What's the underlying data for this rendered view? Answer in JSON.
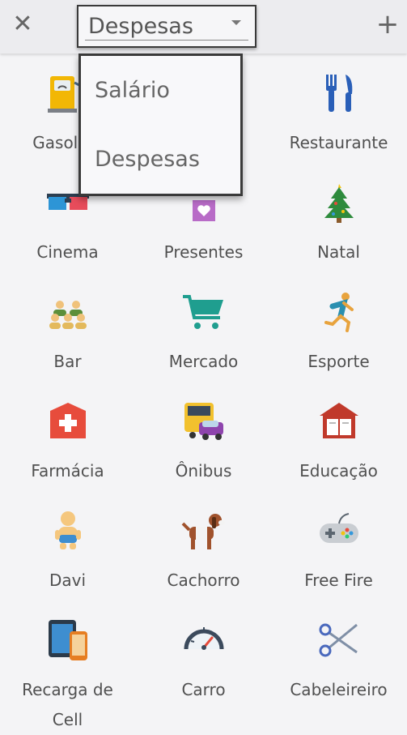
{
  "header": {
    "close_icon": "close-icon",
    "add_icon": "plus-icon",
    "selected_type": "Despesas"
  },
  "dropdown": {
    "options": [
      "Salário",
      "Despesas"
    ]
  },
  "categories": [
    {
      "label": "Gasolina",
      "icon": "fuel-pump-icon"
    },
    {
      "label": "",
      "icon": "hidden-behind-dropdown"
    },
    {
      "label": "Restaurante",
      "icon": "fork-knife-icon"
    },
    {
      "label": "Cinema",
      "icon": "3d-glasses-icon"
    },
    {
      "label": "Presentes",
      "icon": "gift-icon"
    },
    {
      "label": "Natal",
      "icon": "christmas-tree-icon"
    },
    {
      "label": "Bar",
      "icon": "people-group-icon"
    },
    {
      "label": "Mercado",
      "icon": "shopping-cart-icon"
    },
    {
      "label": "Esporte",
      "icon": "runner-icon"
    },
    {
      "label": "Farmácia",
      "icon": "pharmacy-icon"
    },
    {
      "label": "Ônibus",
      "icon": "bus-car-icon"
    },
    {
      "label": "Educação",
      "icon": "school-book-icon"
    },
    {
      "label": "Davi",
      "icon": "baby-icon"
    },
    {
      "label": "Cachorro",
      "icon": "dog-icon"
    },
    {
      "label": "Free Fire",
      "icon": "gamepad-icon"
    },
    {
      "label": "Recarga de Cell",
      "icon": "devices-icon"
    },
    {
      "label": "Carro",
      "icon": "speedometer-icon"
    },
    {
      "label": "Cabeleireiro",
      "icon": "scissors-icon"
    }
  ]
}
